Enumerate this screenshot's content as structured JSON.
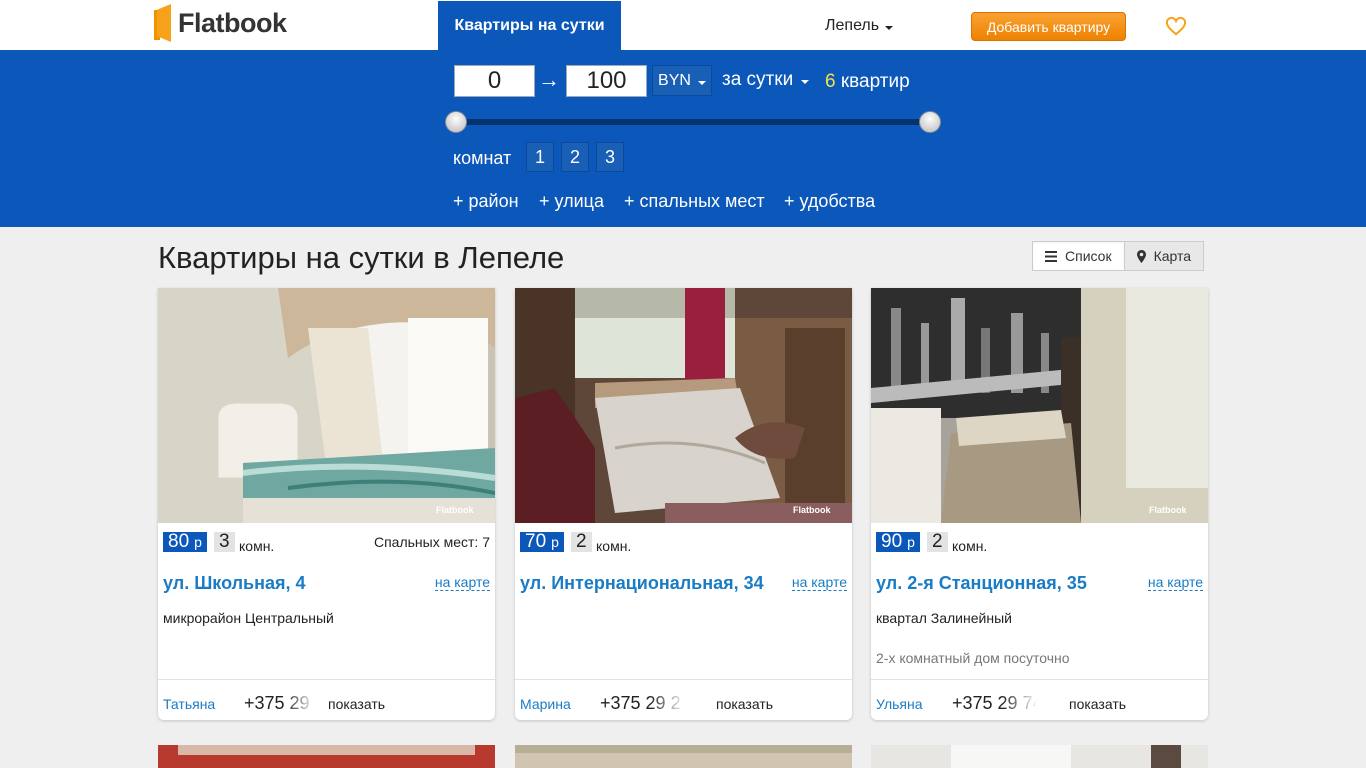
{
  "brand": {
    "name": "Flatbook",
    "color": "#f29100"
  },
  "header": {
    "nav_active": "Квартиры на сутки",
    "city": "Лепель",
    "add_button": "Добавить квартиру"
  },
  "filter": {
    "price_min": "0",
    "price_arrow": "→",
    "price_max": "100",
    "currency": "BYN",
    "period": "за сутки",
    "count_num": "6",
    "count_label": "квартир",
    "slider": {
      "min_fraction": 0,
      "max_fraction": 1
    },
    "rooms_label": "комнат",
    "rooms": [
      "1",
      "2",
      "3"
    ],
    "more": [
      "+ район",
      "+ улица",
      "+ спальных мест",
      "+ удобства"
    ]
  },
  "content": {
    "title": "Квартиры на сутки в Лепеле",
    "view_list": "Список",
    "view_map": "Карта"
  },
  "listings": [
    {
      "price": "80",
      "currency": "р",
      "rooms": "3",
      "rooms_unit": "комн.",
      "beds": "Спальных мест: 7",
      "street": "ул. Школьная, 4",
      "map_link": "на карте",
      "district": "микрорайон Центральный",
      "description": "",
      "owner": "Татьяна",
      "phone": "+375 29",
      "show": "показать",
      "watermark": "Flatbook"
    },
    {
      "price": "70",
      "currency": "р",
      "rooms": "2",
      "rooms_unit": "комн.",
      "beds": "",
      "street": "ул. Интернациональная, 34",
      "map_link": "на карте",
      "district": "",
      "description": "",
      "owner": "Марина",
      "phone": "+375 29 2",
      "show": "показать",
      "watermark": "Flatbook"
    },
    {
      "price": "90",
      "currency": "р",
      "rooms": "2",
      "rooms_unit": "комн.",
      "beds": "",
      "street": "ул. 2-я Станционная, 35",
      "map_link": "на карте",
      "district": "квартал Залинейный",
      "description": "2-х комнатный дом посуточно",
      "owner": "Ульяна",
      "phone": "+375 29 74",
      "show": "показать",
      "watermark": "Flatbook"
    }
  ],
  "colors": {
    "primary_blue": "#0c57ba",
    "link_blue": "#1a7cc5",
    "accent_orange": "#ee8200",
    "count_yellow": "#f4e24a"
  }
}
